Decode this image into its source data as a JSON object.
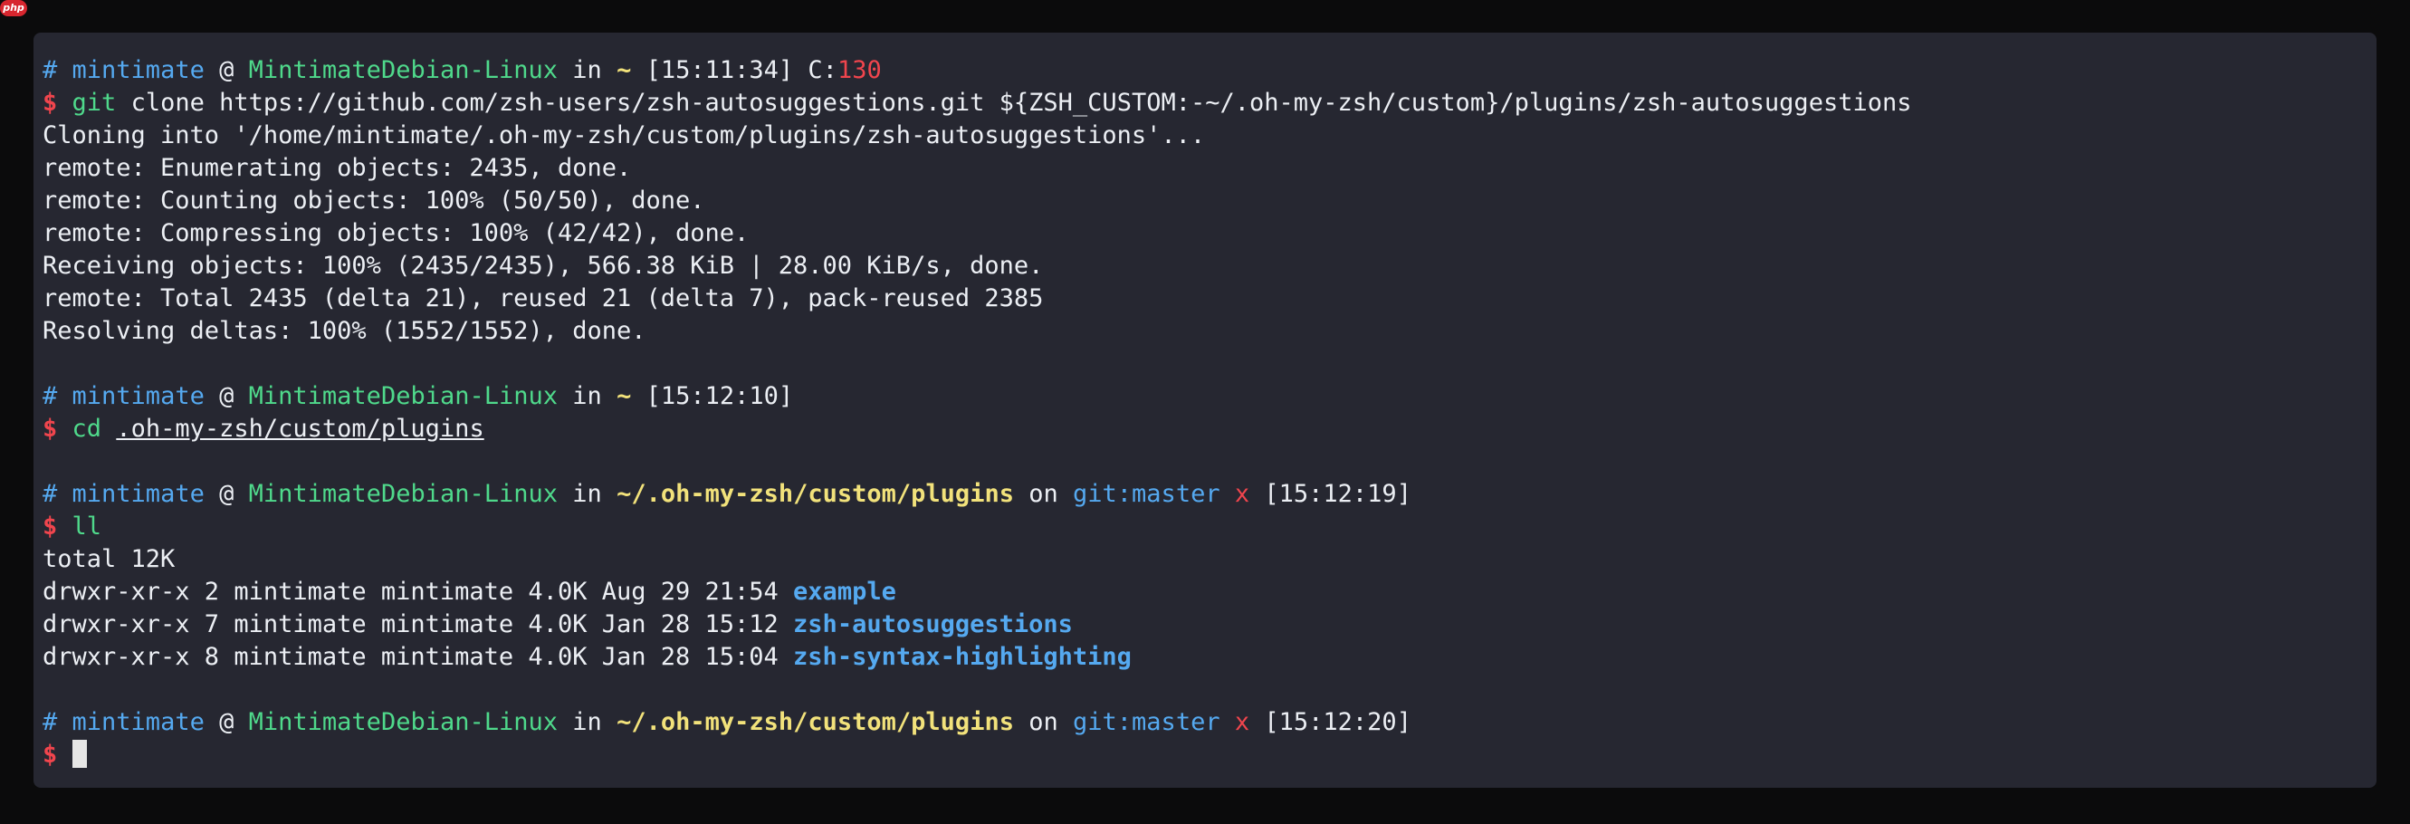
{
  "badge": {
    "label": "php"
  },
  "prompt": {
    "hash": "#",
    "user": "mintimate",
    "at": "@",
    "host": "MintimateDebian-Linux",
    "in": "in",
    "dollar": "$"
  },
  "block1": {
    "path": "~",
    "time": "[15:11:34]",
    "code_label": "C:",
    "code_value": "130",
    "command": "git",
    "args": "clone https://github.com/zsh-users/zsh-autosuggestions.git ${ZSH_CUSTOM:-~/.oh-my-zsh/custom}/plugins/zsh-autosuggestions",
    "output": [
      "Cloning into '/home/mintimate/.oh-my-zsh/custom/plugins/zsh-autosuggestions'...",
      "remote: Enumerating objects: 2435, done.",
      "remote: Counting objects: 100% (50/50), done.",
      "remote: Compressing objects: 100% (42/42), done.",
      "Receiving objects: 100% (2435/2435), 566.38 KiB | 28.00 KiB/s, done.",
      "remote: Total 2435 (delta 21), reused 21 (delta 7), pack-reused 2385",
      "Resolving deltas: 100% (1552/1552), done."
    ]
  },
  "block2": {
    "path": "~",
    "time": "[15:12:10]",
    "command": "cd",
    "arg": ".oh-my-zsh/custom/plugins"
  },
  "block3": {
    "path": "~/.oh-my-zsh/custom/plugins",
    "on": "on",
    "git_label": "git:",
    "branch": "master",
    "dirty": "x",
    "time": "[15:12:19]",
    "command": "ll",
    "total": "total 12K",
    "listing": [
      {
        "meta": "drwxr-xr-x 2 mintimate mintimate 4.0K Aug 29 21:54",
        "name": "example"
      },
      {
        "meta": "drwxr-xr-x 7 mintimate mintimate 4.0K Jan 28 15:12",
        "name": "zsh-autosuggestions"
      },
      {
        "meta": "drwxr-xr-x 8 mintimate mintimate 4.0K Jan 28 15:04",
        "name": "zsh-syntax-highlighting"
      }
    ]
  },
  "block4": {
    "path": "~/.oh-my-zsh/custom/plugins",
    "on": "on",
    "git_label": "git:",
    "branch": "master",
    "dirty": "x",
    "time": "[15:12:20]"
  },
  "colors": {
    "background": "#0b0b0c",
    "terminal_bg": "#262731",
    "text": "#eceff4",
    "blue": "#55a9f0",
    "green": "#4fd98b",
    "yellow": "#f2e27b",
    "red": "#f0454d"
  }
}
